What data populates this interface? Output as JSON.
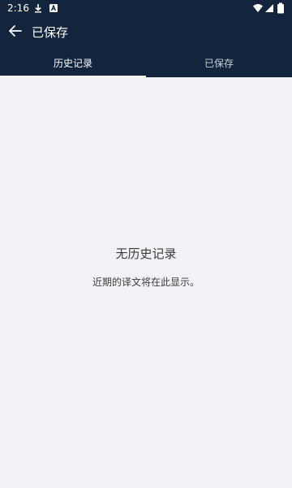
{
  "status_bar": {
    "time": "2:16",
    "icons": [
      "download-icon",
      "notification-a-icon",
      "wifi-icon",
      "signal-icon",
      "battery-icon"
    ]
  },
  "app_bar": {
    "back_icon": "arrow-left-icon",
    "title": "已保存"
  },
  "tabs": [
    {
      "label": "历史记录",
      "active": true
    },
    {
      "label": "已保存",
      "active": false
    }
  ],
  "empty_state": {
    "title": "无历史记录",
    "subtitle": "近期的译文将在此显示。"
  },
  "colors": {
    "header_bg": "#12253d",
    "body_bg": "#f2f1f6",
    "text_dark": "#3b3b3b",
    "tab_indicator": "#ffffff"
  }
}
